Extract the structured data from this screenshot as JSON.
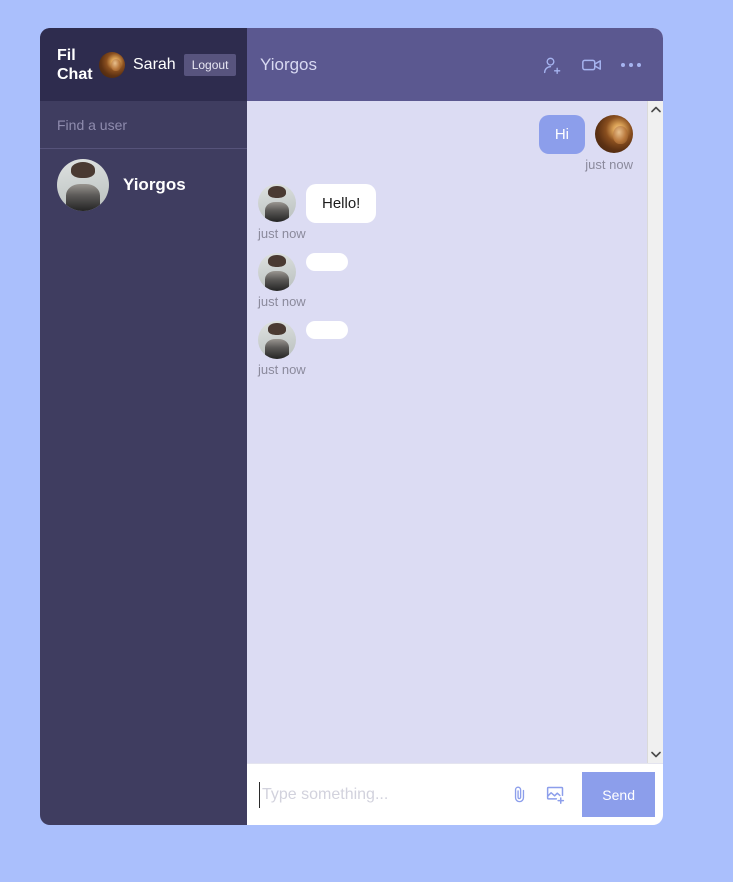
{
  "app": {
    "brand_line1": "Fil",
    "brand_line2": "Chat"
  },
  "sidebar": {
    "current_user": {
      "name": "Sarah",
      "avatar_name": "sarah-avatar"
    },
    "logout_label": "Logout",
    "search": {
      "placeholder": "Find a user",
      "value": ""
    },
    "users": [
      {
        "name": "Yiorgos",
        "avatar_name": "yiorgos-avatar"
      }
    ]
  },
  "chat": {
    "title": "Yiorgos",
    "header_icons": [
      {
        "name": "add-person-icon"
      },
      {
        "name": "video-call-icon"
      },
      {
        "name": "more-options-icon"
      }
    ],
    "messages": [
      {
        "direction": "out",
        "text": "Hi",
        "timestamp": "just now",
        "empty": false
      },
      {
        "direction": "in",
        "text": "Hello!",
        "timestamp": "just now",
        "empty": false
      },
      {
        "direction": "in",
        "text": "",
        "timestamp": "just now",
        "empty": true
      },
      {
        "direction": "in",
        "text": "",
        "timestamp": "just now",
        "empty": true
      }
    ]
  },
  "composer": {
    "placeholder": "Type something...",
    "value": "",
    "attach_icon": "paperclip-icon",
    "image_icon": "add-image-icon",
    "send_label": "Send"
  },
  "scrollbar": {
    "up_arrow": "⌃",
    "down_arrow": "⌄"
  },
  "colors": {
    "page_background": "#aabffc",
    "sidebar": "#3f3d60",
    "sidebar_header": "#2e2c4e",
    "chat_header": "#5b5890",
    "messages_background": "#dcdcf3",
    "accent": "#8c9eeb",
    "bubble_in": "#ffffff"
  }
}
